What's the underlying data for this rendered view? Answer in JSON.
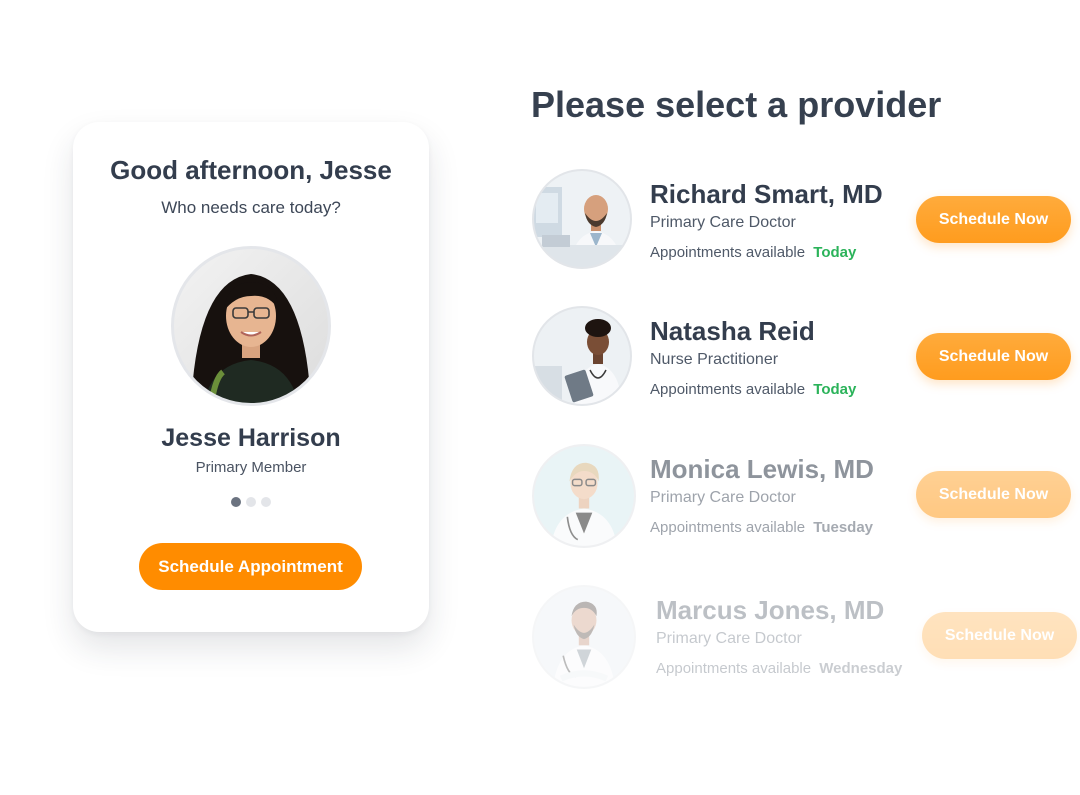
{
  "page_title": "Please select a provider",
  "member_card": {
    "greeting": "Good afternoon, Jesse",
    "prompt": "Who needs care today?",
    "member_name": "Jesse Harrison",
    "member_role": "Primary Member",
    "carousel": {
      "total": 3,
      "active": 1
    },
    "schedule_button_label": "Schedule Appointment",
    "accent_color": "#ff8c00"
  },
  "providers": [
    {
      "name": "Richard Smart, MD",
      "title": "Primary Care Doctor",
      "availability_prefix": "Appointments available",
      "availability_day": "Today",
      "button_label": "Schedule Now"
    },
    {
      "name": "Natasha Reid",
      "title": "Nurse Practitioner",
      "availability_prefix": "Appointments available",
      "availability_day": "Today",
      "button_label": "Schedule Now"
    },
    {
      "name": "Monica Lewis, MD",
      "title": "Primary Care Doctor",
      "availability_prefix": "Appointments available",
      "availability_day": "Tuesday",
      "button_label": "Schedule Now"
    },
    {
      "name": "Marcus Jones, MD",
      "title": "Primary Care Doctor",
      "availability_prefix": "Appointments available",
      "availability_day": "Wednesday",
      "button_label": "Schedule Now"
    }
  ],
  "colors": {
    "today": "#2bb35a",
    "button": "#ffa22a",
    "heading": "#36404f"
  }
}
